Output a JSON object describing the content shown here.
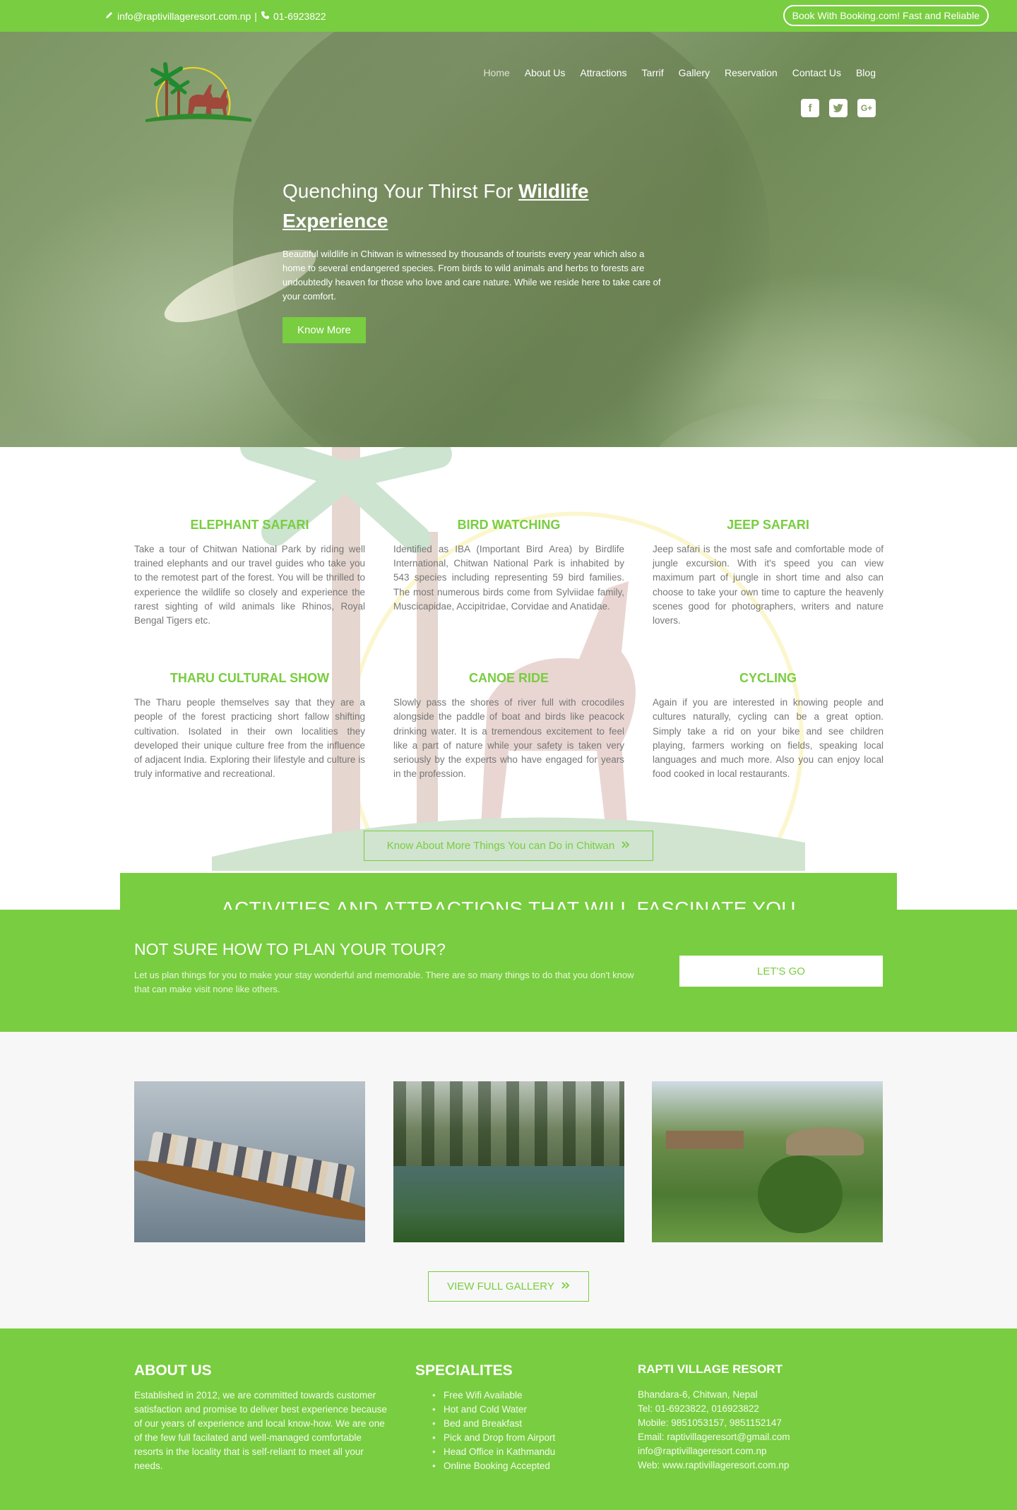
{
  "topbar": {
    "email": "info@raptivillageresort.com.np",
    "separator": "|",
    "phone": "01-6923822",
    "booking_label": "Book With Booking.com! Fast and Reliable"
  },
  "nav": {
    "items": [
      "Home",
      "About Us",
      "Attractions",
      "Tarrif",
      "Gallery",
      "Reservation",
      "Contact Us",
      "Blog"
    ]
  },
  "social": [
    "facebook-icon",
    "twitter-icon",
    "google-plus-icon"
  ],
  "hero": {
    "title_prefix": "Quenching Your Thirst For ",
    "title_strong": "Wildlife Experience",
    "description": "Beautiful wildlife in Chitwan is witnessed by thousands of tourists every year which also a home to several endangered species. From birds to wild animals and herbs to forests are undoubtedly heaven for those who love and care nature. While we reside here to take care of your comfort.",
    "button": "Know More"
  },
  "activities": {
    "heading": "ACTIVITIES AND ATTRACTIONS THAT WILL FASCINATE YOU",
    "items": [
      {
        "title": "ELEPHANT SAFARI",
        "text": "Take a tour of Chitwan National Park by riding well trained elephants and our travel guides who take you to the remotest part of the forest. You will be thrilled to experience the wildlife so closely and experience the rarest sighting of wild animals like Rhinos, Royal Bengal Tigers etc."
      },
      {
        "title": "BIRD WATCHING",
        "text": "Identified as IBA (Important Bird Area) by Birdlife International, Chitwan National Park is inhabited by 543 species including  representing 59 bird families. The most numerous birds come from Sylviidae family, Muscicapidae, Accipitridae, Corvidae and Anatidae."
      },
      {
        "title": "JEEP SAFARI",
        "text": "Jeep safari is the most safe and comfortable mode of jungle excursion. With it's speed you can view maximum part of jungle in short time and also can choose to take your own time to capture the heavenly scenes good for photographers, writers and nature lovers."
      },
      {
        "title": "THARU CULTURAL SHOW",
        "text": "The Tharu people themselves say that they are a people of the forest practicing short fallow shifting cultivation. Isolated in their own localities they developed their unique culture free from the influence of adjacent India. Exploring their lifestyle and culture is truly informative and recreational."
      },
      {
        "title": "CANOE RIDE",
        "text": "Slowly pass the shores of river full with crocodiles alongside the paddle of boat and birds like peacock drinking water. It is a tremendous excitement to feel like a part of nature while your safety is taken very seriously by the experts who have engaged for years in the profession."
      },
      {
        "title": "CYCLING",
        "text": "Again if you are interested in knowing people and cultures naturally, cycling can be a great option. Simply take a rid on your bike and see children playing, farmers working on fields, speaking local languages and much more. Also you can enjoy local food cooked in local restaurants."
      }
    ],
    "more_button": "Know About More Things You can Do in Chitwan"
  },
  "plan": {
    "title": "NOT SURE HOW TO PLAN YOUR TOUR?",
    "text": "Let us plan things for you to make your stay wonderful and memorable. There are so many things to do that you don't know that can make visit none like others.",
    "button": "LET'S GO"
  },
  "gallery": {
    "button": "VIEW FULL GALLERY"
  },
  "footer": {
    "about": {
      "title": "ABOUT US",
      "text": "Established in 2012, we are committed towards customer satisfaction and promise to deliver best experience because of our years of experience and local know-how. We are one of the few full facilated and well-managed comfortable resorts in the locality that is self-reliant to meet all your needs."
    },
    "specialites": {
      "title": "SPECIALITES",
      "items": [
        "Free Wifi Available",
        "Hot and Cold Water",
        "Bed and Breakfast",
        "Pick and Drop from Airport",
        "Head Office in Kathmandu",
        "Online Booking Accepted"
      ]
    },
    "contact": {
      "title": "RAPTI VILLAGE RESORT",
      "lines": [
        "Bhandara-6, Chitwan, Nepal",
        "Tel: 01-6923822, 016923822",
        "Mobile: 9851053157, 9851152147",
        "Email: raptivillageresort@gmail.com",
        "info@raptivillageresort.com.np",
        "Web: www.raptivillageresort.com.np"
      ]
    }
  },
  "colors": {
    "brand_green": "#79cd40",
    "white": "#ffffff",
    "text_gray": "#777777"
  }
}
